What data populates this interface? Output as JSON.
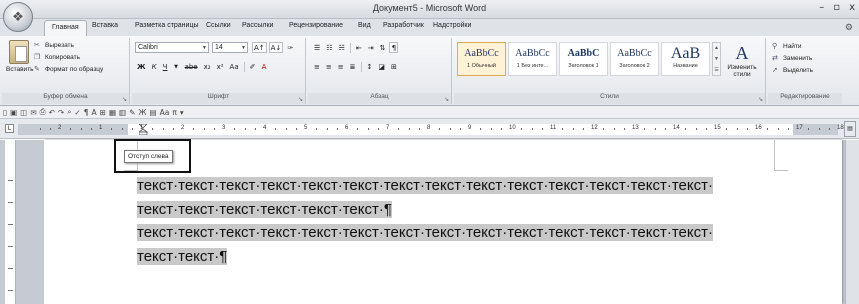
{
  "window": {
    "title": "Документ5 - Microsoft Word",
    "controls": [
      "–",
      "▫",
      "x"
    ]
  },
  "tabs": [
    {
      "label": "Главная",
      "active": true
    },
    {
      "label": "Вставка"
    },
    {
      "label": "Разметка страницы"
    },
    {
      "label": "Ссылки"
    },
    {
      "label": "Рассылки"
    },
    {
      "label": "Рецензирование"
    },
    {
      "label": "Вид"
    },
    {
      "label": "Разработчик"
    },
    {
      "label": "Надстройки"
    }
  ],
  "ribbon": {
    "clipboard": {
      "paste_label": "Вставить",
      "cut_label": "Вырезать",
      "copy_label": "Копировать",
      "format_painter_label": "Формат по образцу",
      "group_label": "Буфер обмена"
    },
    "font": {
      "font_name": "Calibri",
      "font_size": "14",
      "group_label": "Шрифт"
    },
    "paragraph": {
      "group_label": "Абзац"
    },
    "styles": {
      "items": [
        {
          "sample": "AaBbCc",
          "name": "1 Обычный",
          "selected": true
        },
        {
          "sample": "AaBbCc",
          "name": "1 Без инте..."
        },
        {
          "sample": "AaBbC",
          "name": "Заголовок 1"
        },
        {
          "sample": "AaBbCc",
          "name": "Заголовок 2"
        },
        {
          "sample": "AaB",
          "name": "Название"
        }
      ],
      "change_styles_label": "Изменить стили",
      "group_label": "Стили"
    },
    "editing": {
      "find_label": "Найти",
      "replace_label": "Заменить",
      "select_label": "Выделить",
      "group_label": "Редактирование"
    }
  },
  "ruler": {
    "numbers": [
      "2",
      "1",
      "1",
      "2",
      "3",
      "4",
      "5",
      "6",
      "7",
      "8",
      "9",
      "10",
      "11",
      "12",
      "13",
      "14",
      "15",
      "16",
      "17",
      "18"
    ]
  },
  "tooltip": {
    "text": "Отступ слева"
  },
  "document": {
    "lines": [
      "текст·текст·текст·текст·текст·текст·текст·текст·текст·текст·текст·текст·текст·текст·",
      "текст·текст·текст·текст·текст·текст·¶",
      "текст·текст·текст·текст·текст·текст·текст·текст·текст·текст·текст·текст·текст·текст·",
      "текст·текст·¶"
    ]
  }
}
